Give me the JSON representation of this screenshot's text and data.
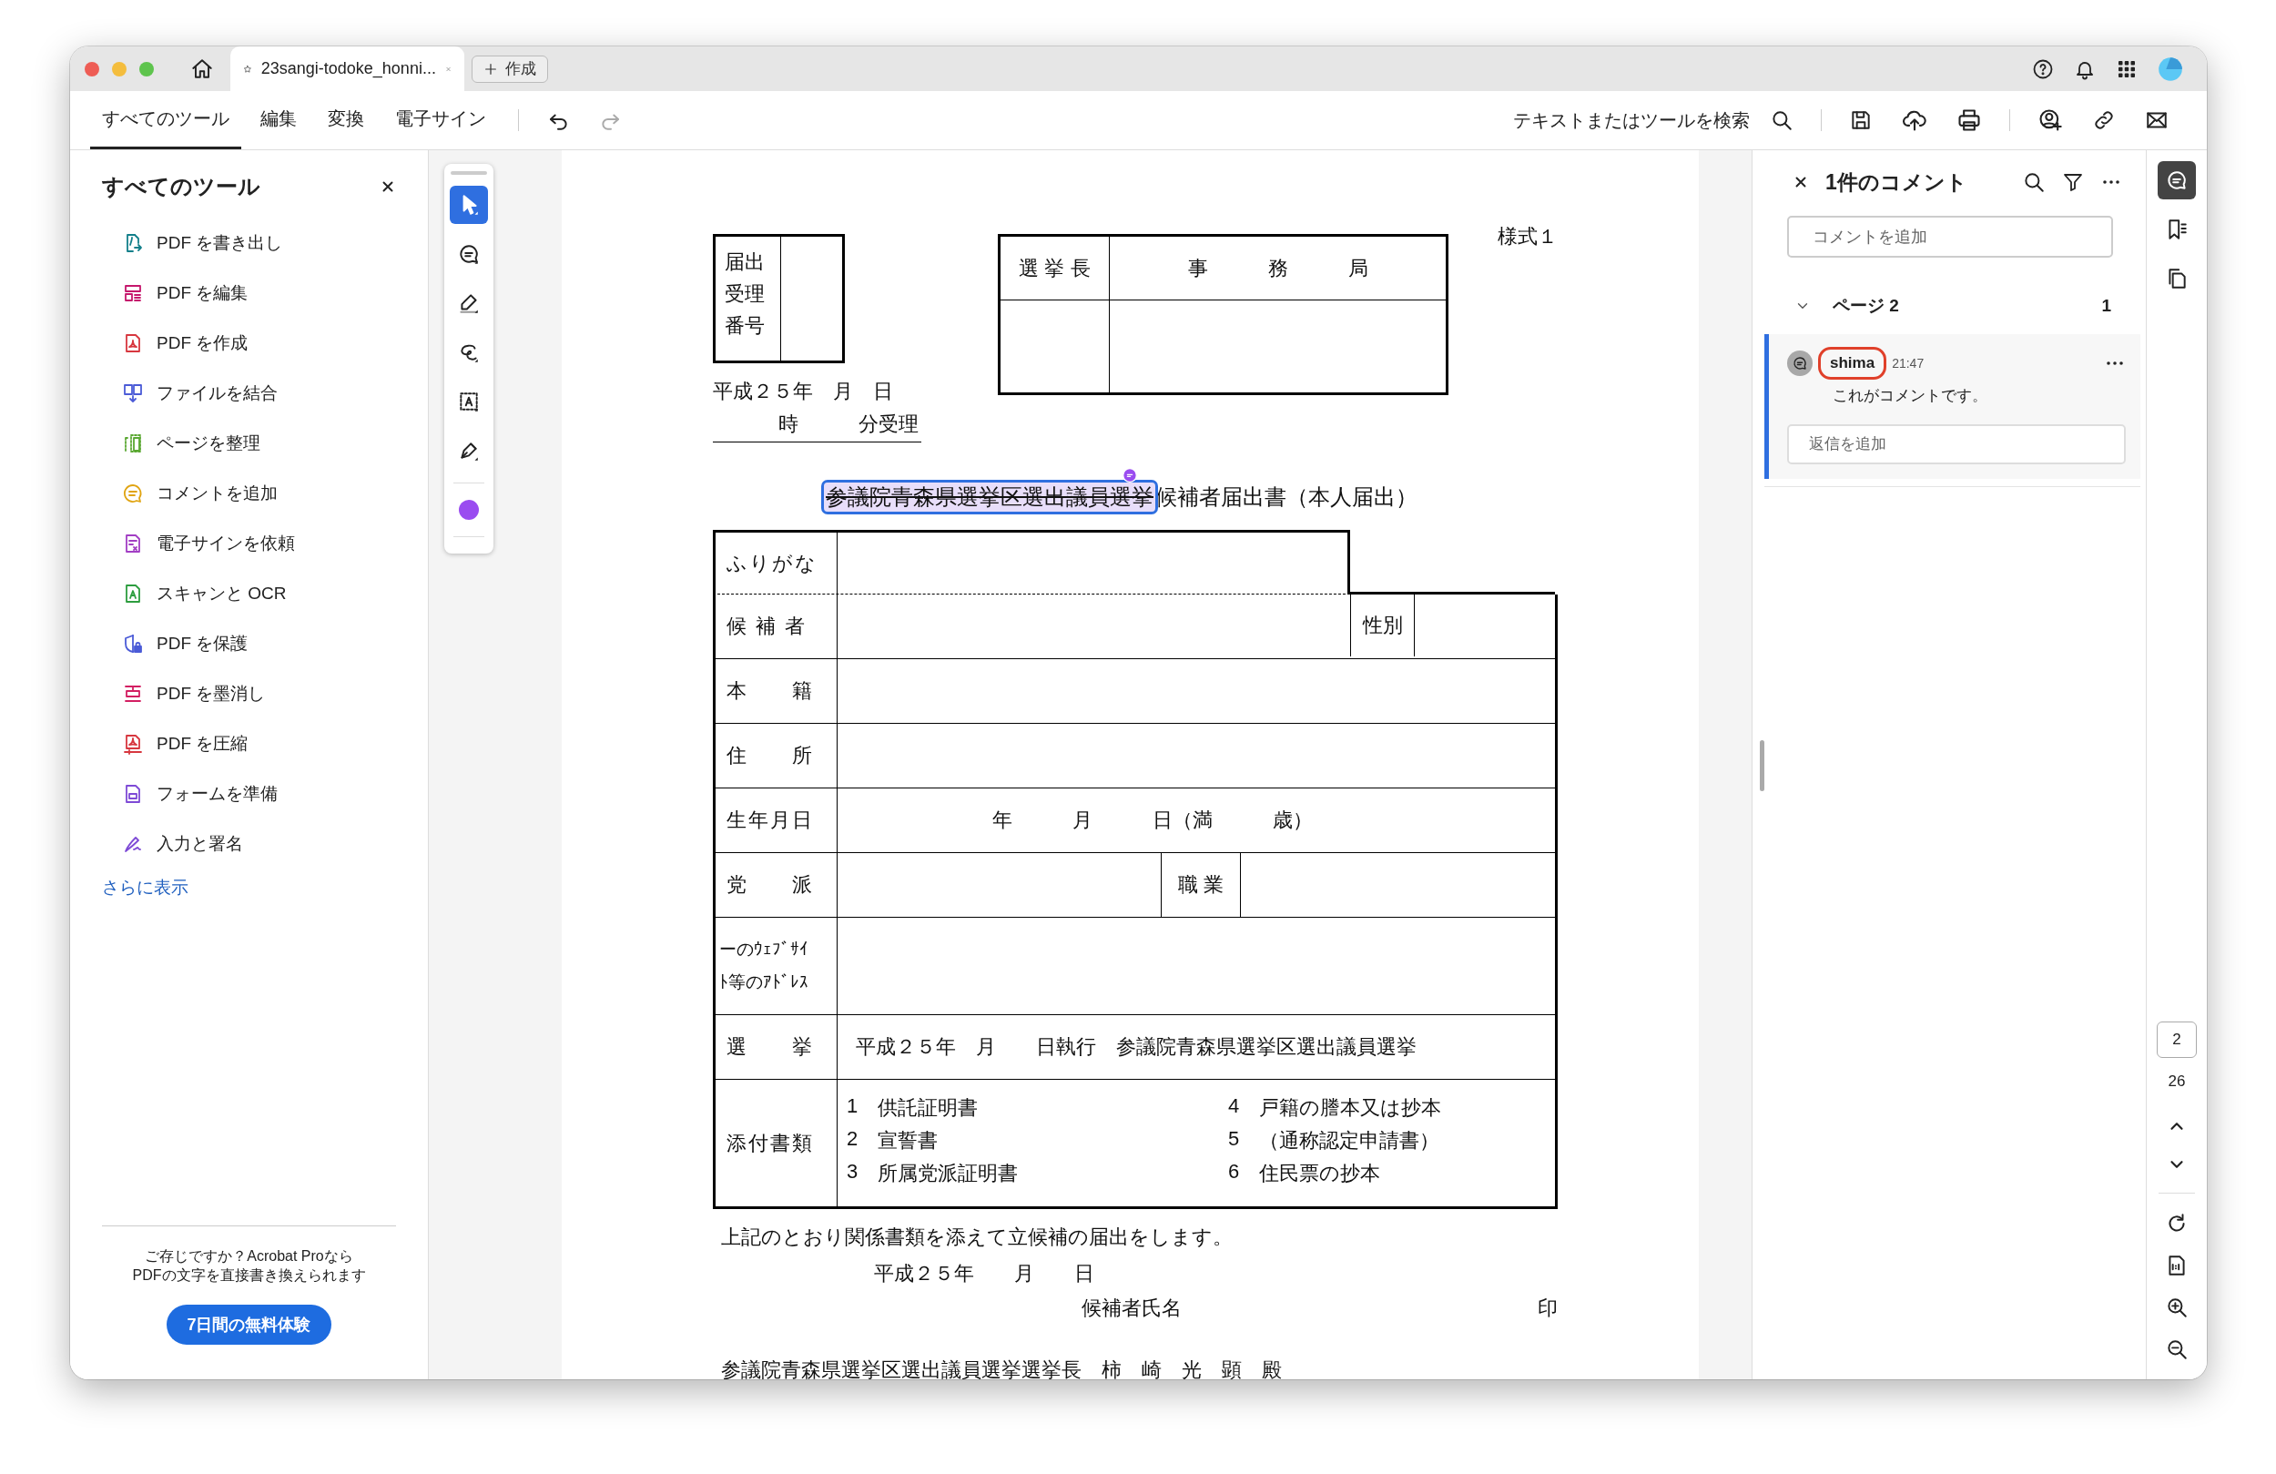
{
  "window": {
    "tab_title": "23sangi-todoke_honni...",
    "new_tab": "作成"
  },
  "toolbar": {
    "tabs": [
      {
        "label": "すべてのツール",
        "selected": true
      },
      {
        "label": "編集",
        "selected": false
      },
      {
        "label": "変換",
        "selected": false
      },
      {
        "label": "電子サイン",
        "selected": false
      }
    ],
    "redo_disabled": true,
    "search": "テキストまたはツールを検索"
  },
  "tools_panel": {
    "title": "すべてのツール",
    "items": [
      {
        "label": "PDF を書き出し"
      },
      {
        "label": "PDF を編集"
      },
      {
        "label": "PDF を作成"
      },
      {
        "label": "ファイルを結合"
      },
      {
        "label": "ページを整理"
      },
      {
        "label": "コメントを追加"
      },
      {
        "label": "電子サインを依頼"
      },
      {
        "label": "スキャンと OCR"
      },
      {
        "label": "PDF を保護"
      },
      {
        "label": "PDF を墨消し"
      },
      {
        "label": "PDF を圧縮"
      },
      {
        "label": "フォームを準備"
      },
      {
        "label": "入力と署名"
      }
    ],
    "more": "さらに表示",
    "promo": "ご存じですか？Acrobat Proなら\nPDFの文字を直接書き換えられます",
    "trial_button": "7日間の無料体験"
  },
  "palette": {
    "tools": [
      {
        "kind": "select",
        "selected": true
      },
      {
        "kind": "comment",
        "selected": false
      },
      {
        "kind": "highlight",
        "selected": false
      },
      {
        "kind": "draw",
        "selected": false
      },
      {
        "kind": "text",
        "selected": false
      },
      {
        "kind": "sign",
        "selected": false
      }
    ],
    "color": "#9a4cf0"
  },
  "document": {
    "form_number": "様式１",
    "receipt_label": "届出受理番号",
    "office_headers": [
      "選 挙 長",
      "事　　　務　　　局"
    ],
    "received_date": "平成２５年　月　日",
    "received_time": "時　　　分受理",
    "title": {
      "struck": "参議院青森県選挙区選出議員選挙",
      "rest": "候補者届出書（本人届出）",
      "commented": true
    },
    "rows": [
      {
        "kind": "furigana",
        "label": "ふりがな"
      },
      {
        "kind": "split_right",
        "label": "候 補 者",
        "side_label": "性別"
      },
      {
        "kind": "plain",
        "label": "本　　籍"
      },
      {
        "kind": "plain",
        "label": "住　　所"
      },
      {
        "kind": "centered_value",
        "label": "生年月日",
        "value": "年　　　月　　　日（満　　　歳）"
      },
      {
        "kind": "split_mid",
        "label": "党　　派",
        "side_label": "職 業"
      },
      {
        "kind": "tall",
        "label": "ーのｳｪﾌﾞｻｲﾄ等のｱﾄﾞﾚｽ"
      },
      {
        "kind": "value",
        "label": "選　　挙",
        "value": "平成２５年　月　　日執行　参議院青森県選挙区選出議員選挙"
      },
      {
        "kind": "list",
        "label": "添付書類",
        "items": [
          {
            "number": "1",
            "text": "供託証明書"
          },
          {
            "number": "2",
            "text": "宣誓書"
          },
          {
            "number": "3",
            "text": "所属党派証明書"
          },
          {
            "number": "4",
            "text": "戸籍の謄本又は抄本"
          },
          {
            "number": "5",
            "text": "（通称認定申請書）"
          },
          {
            "number": "6",
            "text": "住民票の抄本"
          }
        ]
      }
    ],
    "declaration": "上記のとおり関係書類を添えて立候補の届出をします。",
    "date": "平成２５年　　月　　日",
    "name_label": "候補者氏名",
    "seal": "印",
    "addressee": "参議院青森県選挙区選出議員選挙選挙長　柿　崎　光　顕　殿"
  },
  "comments": {
    "title": "1件のコメント",
    "add_placeholder": "コメントを追加",
    "groups": [
      {
        "label": "ページ 2",
        "count": "1",
        "expanded": true,
        "comments": [
          {
            "author": "shima",
            "time": "21:47",
            "text": "これがコメントです。",
            "reply_placeholder": "返信を追加",
            "selected": true,
            "circled": true
          }
        ]
      }
    ]
  },
  "rail": {
    "tools": [
      {
        "kind": "comments",
        "selected": true
      },
      {
        "kind": "bookmarks",
        "selected": false
      },
      {
        "kind": "pages",
        "selected": false
      }
    ],
    "page": "2",
    "page_count": "26"
  }
}
